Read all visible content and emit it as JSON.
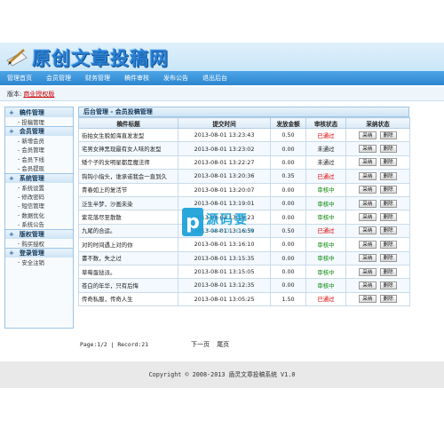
{
  "header": {
    "logo_text": "原创文章投稿网"
  },
  "nav": {
    "items": [
      "管理首页",
      "会员管理",
      "财务管理",
      "稿件审核",
      "发布公告",
      "退出后台"
    ]
  },
  "toolbar": {
    "label": "版本:",
    "link": "商业授权版"
  },
  "sidebar": {
    "groups": [
      {
        "title": "稿件管理",
        "items": [
          "投稿管理"
        ]
      },
      {
        "title": "会员管理",
        "items": [
          "新增会员",
          "会员管理",
          "会员下线",
          "会员提现"
        ]
      },
      {
        "title": "系统管理",
        "items": [
          "系统设置",
          "修改密码",
          "短信管理",
          "数据优化",
          "系统公告"
        ]
      },
      {
        "title": "版权管理",
        "items": [
          "购买授权"
        ]
      },
      {
        "title": "登录管理",
        "items": [
          "安全注销"
        ]
      }
    ]
  },
  "main": {
    "header": "后台管理 - 会员投稿管理",
    "columns": [
      "稿件标题",
      "提交时间",
      "发放金额",
      "审核状态",
      "采纳状态"
    ],
    "accept_label": "采纳",
    "delete_label": "删除",
    "rows": [
      {
        "title": "街拍女生貌如海直发发型",
        "time": "2013-08-01 13:23:43",
        "amount": "0.50",
        "status": "已通过",
        "status_color": "#e00000"
      },
      {
        "title": "宅男女神黑现最有女人味的发型",
        "time": "2013-08-01 13:23:02",
        "amount": "0.00",
        "status": "未通过",
        "status_color": "#222222"
      },
      {
        "title": "矮个子的女明星都是魔法师",
        "time": "2013-08-01 13:22:27",
        "amount": "0.00",
        "status": "未通过",
        "status_color": "#222222"
      },
      {
        "title": "钩钩小指头，谁承诺我会一直到久",
        "time": "2013-08-01 13:20:36",
        "amount": "0.35",
        "status": "已通过",
        "status_color": "#e00000"
      },
      {
        "title": "青春如上的复活节",
        "time": "2013-08-01 13:20:07",
        "amount": "0.00",
        "status": "审核中",
        "status_color": "#118a11"
      },
      {
        "title": "泛生半梦，沙画未染",
        "time": "2013-08-01 13:19:01",
        "amount": "0.00",
        "status": "审核中",
        "status_color": "#118a11"
      },
      {
        "title": "紫花落尽至散散",
        "time": "2013-08-01 13:18:23",
        "amount": "0.00",
        "status": "审核中",
        "status_color": "#118a11"
      },
      {
        "title": "九尾的合运。",
        "time": "2013-08-01 13:16:59",
        "amount": "0.50",
        "status": "已通过",
        "status_color": "#e00000"
      },
      {
        "title": "对的时间遇上对的你",
        "time": "2013-08-01 13:16:10",
        "amount": "0.00",
        "status": "审核中",
        "status_color": "#118a11"
      },
      {
        "title": "書不数，失之过",
        "time": "2013-08-01 13:15:35",
        "amount": "0.00",
        "status": "审核中",
        "status_color": "#118a11"
      },
      {
        "title": "草莓蛋挞派。",
        "time": "2013-08-01 13:15:05",
        "amount": "0.00",
        "status": "审核中",
        "status_color": "#118a11"
      },
      {
        "title": "苍白的年华，只有后悔",
        "time": "2013-08-01 13:12:35",
        "amount": "0.00",
        "status": "审核中",
        "status_color": "#118a11"
      },
      {
        "title": "传奇私服，传奇人生",
        "time": "2013-08-01 13:05:25",
        "amount": "1.50",
        "status": "已通过",
        "status_color": "#e00000"
      }
    ]
  },
  "pager": {
    "info": "Page:1/2 | Record:21",
    "next": "下一页",
    "last": "尾页"
  },
  "footer": {
    "text": "Copyright © 2008-2013 盾灵文章投稿系统 V1.0"
  },
  "watermark": {
    "logo": "p",
    "main": "源码要",
    "sub": "YMPO.COM"
  }
}
